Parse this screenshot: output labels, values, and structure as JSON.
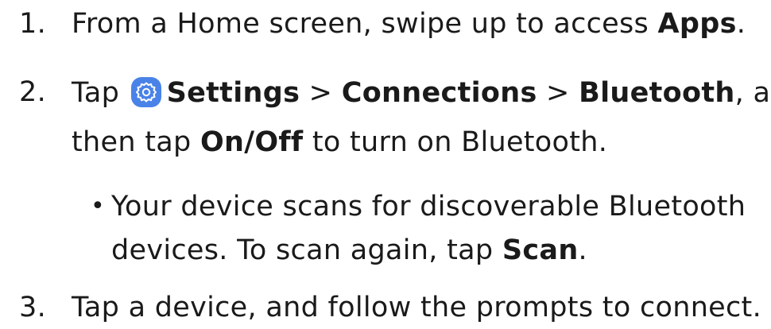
{
  "steps": [
    {
      "number": "1.",
      "text_before": "From a Home screen, swipe up to access ",
      "bold": "Apps",
      "text_after": "."
    },
    {
      "number": "2.",
      "prefix": "Tap",
      "icon": "settings-gear-icon",
      "icon_color": "#4a83e8",
      "settings": "Settings",
      "sep1": ">",
      "connections": "Connections",
      "sep2": ">",
      "bluetooth": "Bluetooth",
      "after_bluetooth": ", and",
      "line2_before": "then tap ",
      "onoff": "On/Off",
      "line2_after": " to turn on Bluetooth.",
      "bullet": {
        "symbol": "•",
        "line1": "Your device scans for discoverable Bluetooth",
        "line2_before": "devices. To scan again, tap ",
        "scan": "Scan",
        "line2_after": "."
      }
    },
    {
      "number": "3.",
      "text": "Tap a device, and follow the prompts to connect."
    }
  ]
}
